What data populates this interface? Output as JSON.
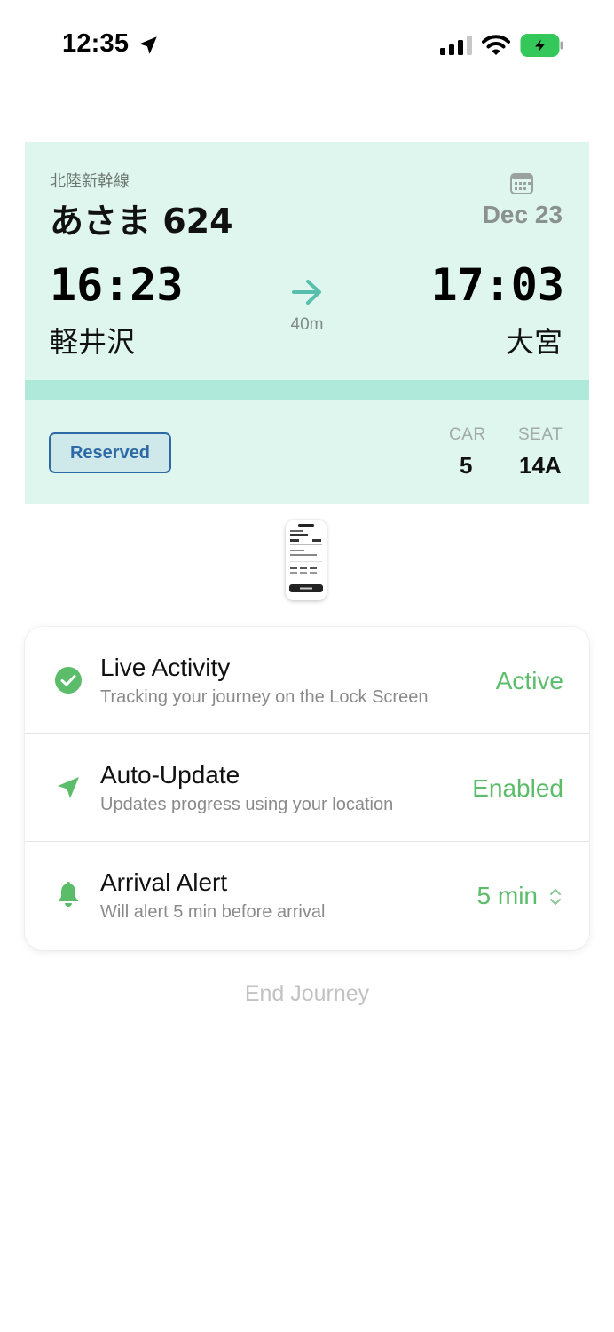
{
  "status_bar": {
    "time": "12:35",
    "location_icon": "location-arrow-icon",
    "signal_icon": "cellular-signal-icon",
    "wifi_icon": "wifi-icon",
    "battery_icon": "battery-charging-icon",
    "battery_color": "#34c759"
  },
  "ticket": {
    "line": "北陸新幹線",
    "train": "あさま 624",
    "calendar_icon": "calendar-icon",
    "date": "Dec 23",
    "departure": {
      "time": "16:23",
      "station": "軽井沢"
    },
    "arrival": {
      "time": "17:03",
      "station": "大宮"
    },
    "arrow_icon": "arrow-right-icon",
    "duration": "40m",
    "status_badge": "Reserved",
    "car_label": "CAR",
    "car_value": "5",
    "seat_label": "SEAT",
    "seat_value": "14A",
    "background_color": "#dff6ef",
    "stripe_color": "#aee9d9",
    "badge_color": "#2d6aa5"
  },
  "settings": {
    "accent_color": "#5bbd6a",
    "rows": [
      {
        "icon": "checkmark-circle-icon",
        "title": "Live Activity",
        "subtitle": "Tracking your journey on the Lock Screen",
        "value": "Active"
      },
      {
        "icon": "location-arrow-icon",
        "title": "Auto-Update",
        "subtitle": "Updates progress using your location",
        "value": "Enabled"
      },
      {
        "icon": "bell-icon",
        "title": "Arrival Alert",
        "subtitle": "Will alert 5 min before arrival",
        "value": "5 min",
        "value_icon": "chevron-up-down-icon"
      }
    ]
  },
  "end_journey_label": "End Journey"
}
